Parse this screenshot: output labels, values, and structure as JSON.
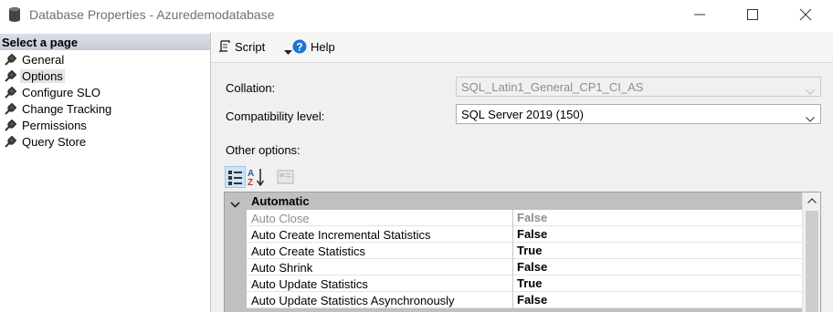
{
  "window": {
    "title": "Database Properties - Azuredemodatabase"
  },
  "left_pane": {
    "header": "Select a page",
    "items": [
      {
        "label": "General"
      },
      {
        "label": "Options"
      },
      {
        "label": "Configure SLO"
      },
      {
        "label": "Change Tracking"
      },
      {
        "label": "Permissions"
      },
      {
        "label": "Query Store"
      }
    ],
    "selected": "Options"
  },
  "toolbar": {
    "script_label": "Script",
    "help_label": "Help"
  },
  "form": {
    "collation_label": "Collation:",
    "collation_value": "SQL_Latin1_General_CP1_CI_AS",
    "compat_label": "Compatibility level:",
    "compat_value": "SQL Server 2019 (150)",
    "other_options_label": "Other options:"
  },
  "property_grid": {
    "category": "Automatic",
    "rows": [
      {
        "name": "Auto Close",
        "value": "False",
        "disabled": true
      },
      {
        "name": "Auto Create Incremental Statistics",
        "value": "False",
        "disabled": false
      },
      {
        "name": "Auto Create Statistics",
        "value": "True",
        "disabled": false
      },
      {
        "name": "Auto Shrink",
        "value": "False",
        "disabled": false
      },
      {
        "name": "Auto Update Statistics",
        "value": "True",
        "disabled": false
      },
      {
        "name": "Auto Update Statistics Asynchronously",
        "value": "False",
        "disabled": false
      }
    ]
  },
  "colors": {
    "selected_button_bg": "#cce4f7",
    "category_bg": "#c0c0c0",
    "help_icon": "#1e73d2"
  },
  "icons": [
    "database-icon",
    "minimize-icon",
    "maximize-icon",
    "close-icon",
    "wrench-icon",
    "script-icon",
    "dropdown-caret-icon",
    "help-icon",
    "chevron-down-icon",
    "categorized-icon",
    "alphabetical-icon",
    "property-pages-icon",
    "collapse-icon",
    "scroll-up-icon"
  ]
}
